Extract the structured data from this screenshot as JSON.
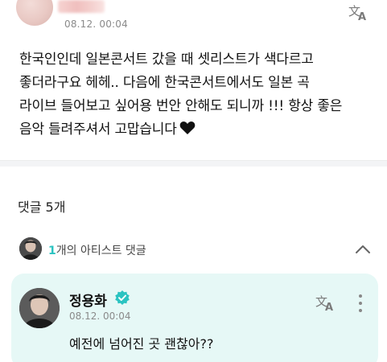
{
  "post": {
    "date": "08.12. 00:04",
    "body_lines": [
      "한국인인데 일본콘서트 갔을 때 셋리스트가 색다르고",
      "좋더라구요 헤헤.. 다음에 한국콘서트에서도 일본 곡",
      "라이브 들어보고 싶어용 번안 안해도 되니까 !!! 항상 좋은",
      "음악 들려주셔서 고맙습니다"
    ]
  },
  "comments": {
    "count_label": "댓글 5개"
  },
  "artist_reply": {
    "count": "1",
    "label": "개의 아티스트 댓글"
  },
  "artist_comment": {
    "name": "정용화",
    "date": "08.12. 00:04",
    "text": "예전에 넘어진 곳 괜찮아??"
  },
  "icons": {
    "translate": "translate-icon",
    "verified": "verified-badge-icon",
    "more": "more-vertical-icon",
    "chevron": "chevron-up-icon",
    "heart": "black-heart-icon"
  },
  "colors": {
    "accent": "#2bc3c1",
    "card_background": "#e6f8f6"
  }
}
